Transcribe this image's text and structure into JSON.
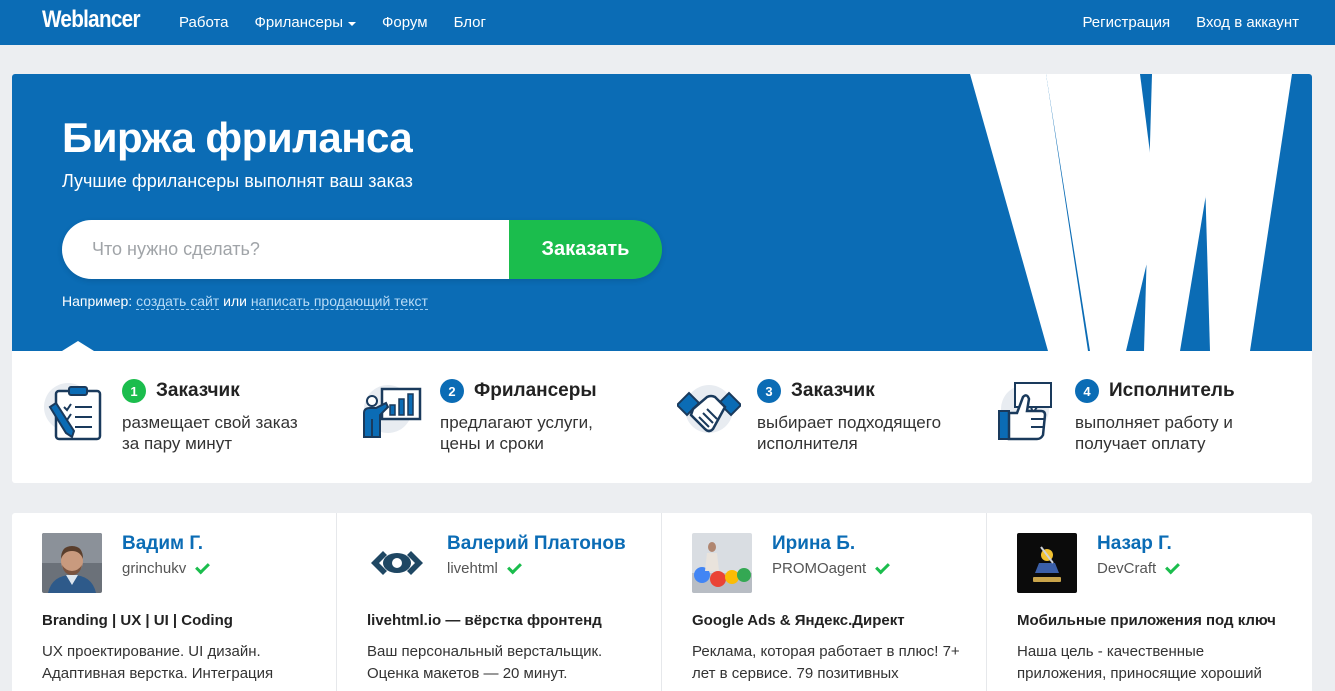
{
  "nav": {
    "logo": "Weblancer",
    "links": [
      "Работа",
      "Фрилансеры",
      "Форум",
      "Блог"
    ],
    "register": "Регистрация",
    "login": "Вход в аккаунт"
  },
  "hero": {
    "title": "Биржа фриланса",
    "subtitle": "Лучшие фрилансеры выполнят ваш заказ",
    "search_placeholder": "Что нужно сделать?",
    "order_button": "Заказать",
    "example_prefix": "Например:",
    "example_link_1": "создать сайт",
    "example_or": "или",
    "example_link_2": "написать продающий текст"
  },
  "steps": [
    {
      "num": "1",
      "title": "Заказчик",
      "text": "размещает свой заказ за пару минут"
    },
    {
      "num": "2",
      "title": "Фрилансеры",
      "text": "предлагают услуги, цены и сроки"
    },
    {
      "num": "3",
      "title": "Заказчик",
      "text": "выбирает подходящего исполнителя"
    },
    {
      "num": "4",
      "title": "Исполнитель",
      "text": "выполняет работу и получает оплату"
    }
  ],
  "freelancers": [
    {
      "name": "Вадим Г.",
      "login": "grinchukv",
      "title": "Branding | UX | UI | Coding",
      "desc": "UX проектирование. UI дизайн. Адаптивная верстка. Интеграция"
    },
    {
      "name": "Валерий Платонов",
      "login": "livehtml",
      "title": "livehtml.io — вёрстка фронтенд",
      "desc": "Ваш персональный верстальщик. Оценка макетов — 20 минут."
    },
    {
      "name": "Ирина Б.",
      "login": "PROMOagent",
      "title": "Google Ads & Яндекс.Директ",
      "desc": "Реклама, которая работает в плюс! 7+ лет в сервисе. 79 позитивных"
    },
    {
      "name": "Назар Г.",
      "login": "DevCraft",
      "title": "Мобильные приложения под ключ",
      "desc": "Наша цель - качественные приложения, приносящие хороший"
    }
  ],
  "colors": {
    "brand": "#0b6cb5",
    "accent": "#1bbd4d"
  }
}
